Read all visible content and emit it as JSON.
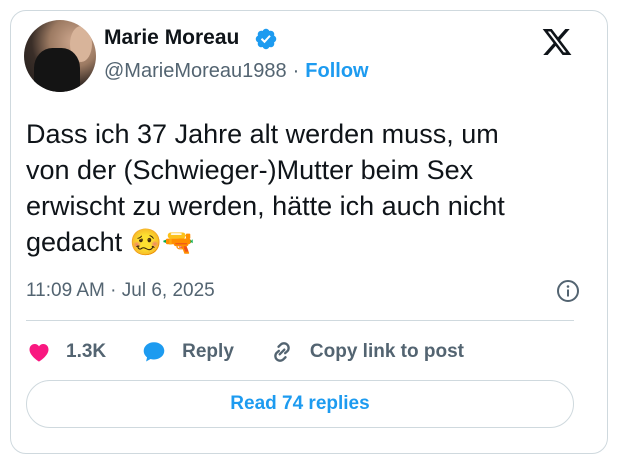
{
  "author": {
    "name": "Marie Moreau",
    "handle": "@MarieMoreau1988",
    "separator": "·",
    "follow_label": "Follow"
  },
  "tweet": {
    "text_lines": [
      "Dass ich 37 Jahre alt werden muss, um",
      "von der (Schwieger-)Mutter beim Sex",
      "erwischt zu werden, hätte ich auch nicht",
      "gedacht"
    ],
    "emojis": [
      "woozy-face",
      "water-pistol"
    ],
    "emoji_chars": [
      "🥴",
      "🔫"
    ],
    "timestamp": "11:09 AM · Jul 6, 2025"
  },
  "actions": {
    "like_count": "1.3K",
    "reply_label": "Reply",
    "copy_label": "Copy link to post"
  },
  "read_replies_label": "Read 74 replies",
  "icons": [
    "verified-badge-icon",
    "x-logo-icon",
    "info-icon",
    "heart-icon",
    "reply-bubble-icon",
    "link-icon"
  ],
  "colors": {
    "accent": "#1d9bf0",
    "like": "#f91880",
    "text": "#0f1419",
    "muted": "#536471",
    "border": "#cfd9de"
  }
}
